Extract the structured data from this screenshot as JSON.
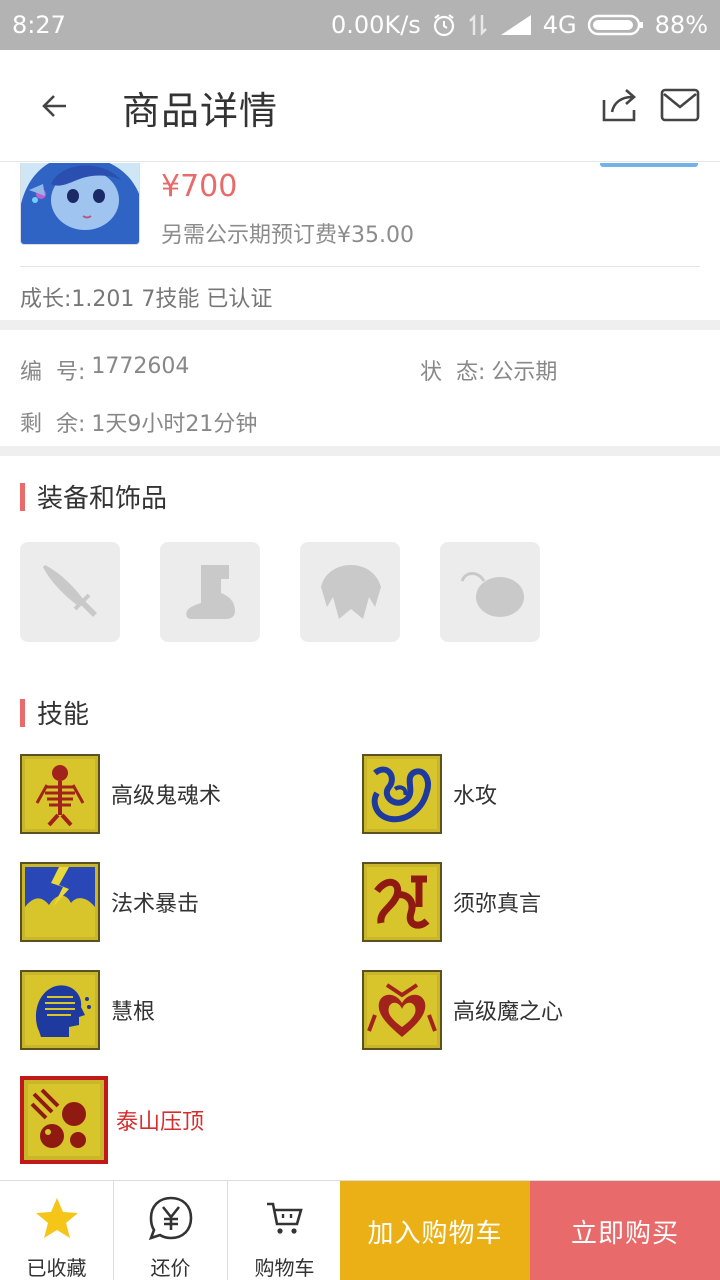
{
  "status_bar": {
    "time": "8:27",
    "network_speed": "0.00K/s",
    "network_type": "4G",
    "battery": "88%"
  },
  "header": {
    "title": "商品详情"
  },
  "product": {
    "price": "¥700",
    "preorder_fee": "另需公示期预订费¥35.00",
    "attributes": "成长:1.201 7技能 已认证"
  },
  "info": {
    "id_label": "编  号:",
    "id_value": "1772604",
    "status_label": "状  态:",
    "status_value": "公示期",
    "remaining_label": "剩  余:",
    "remaining_value": "1天9小时21分钟"
  },
  "equipment_section": {
    "title": "装备和饰品",
    "slots": [
      "sword-icon",
      "boot-icon",
      "armor-icon",
      "accessory-icon"
    ]
  },
  "skills_section": {
    "title": "技能",
    "skills": [
      {
        "name": "高级鬼魂术",
        "icon": "skeleton-icon"
      },
      {
        "name": "水攻",
        "icon": "water-wave-icon"
      },
      {
        "name": "法术暴击",
        "icon": "lightning-icon"
      },
      {
        "name": "须弥真言",
        "icon": "sanskrit-icon"
      },
      {
        "name": "慧根",
        "icon": "head-profile-icon"
      },
      {
        "name": "高级魔之心",
        "icon": "heart-icon"
      },
      {
        "name": "泰山压顶",
        "icon": "falling-rocks-icon"
      }
    ]
  },
  "bottom_bar": {
    "favorite_label": "已收藏",
    "bargain_label": "还价",
    "cart_label": "购物车",
    "add_to_cart": "加入购物车",
    "buy_now": "立即购买"
  },
  "colors": {
    "price_red": "#e86a6a",
    "cart_yellow": "#ebb016",
    "buy_red": "#e86a6a",
    "status_bar_gray": "#b3b3b3"
  }
}
